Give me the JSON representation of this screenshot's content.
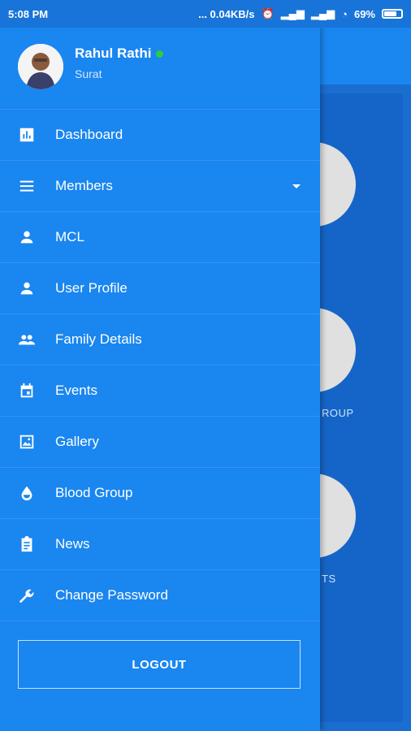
{
  "status_bar": {
    "time": "5:08 PM",
    "data_speed": "... 0.04KB/s",
    "battery": "69%",
    "battery_level": 0.69
  },
  "profile": {
    "name": "Rahul Rathi",
    "city": "Surat",
    "online_color": "#2ecc40"
  },
  "menu": [
    {
      "label": "Dashboard",
      "icon": "dashboard-icon"
    },
    {
      "label": "Members",
      "icon": "menu-icon",
      "has_submenu": true
    },
    {
      "label": "MCL",
      "icon": "person-icon"
    },
    {
      "label": "User Profile",
      "icon": "person-icon"
    },
    {
      "label": "Family Details",
      "icon": "group-icon"
    },
    {
      "label": "Events",
      "icon": "calendar-icon"
    },
    {
      "label": "Gallery",
      "icon": "image-icon"
    },
    {
      "label": "Blood Group",
      "icon": "drop-icon"
    },
    {
      "label": "News",
      "icon": "clipboard-icon"
    },
    {
      "label": "Change Password",
      "icon": "wrench-icon"
    }
  ],
  "logout_label": "LOGOUT",
  "background": {
    "tile_labels": [
      "ROUP",
      "TS"
    ]
  },
  "colors": {
    "drawer": "#1a86f0",
    "status_bar": "#1874d8",
    "background_card": "#1565c8"
  }
}
